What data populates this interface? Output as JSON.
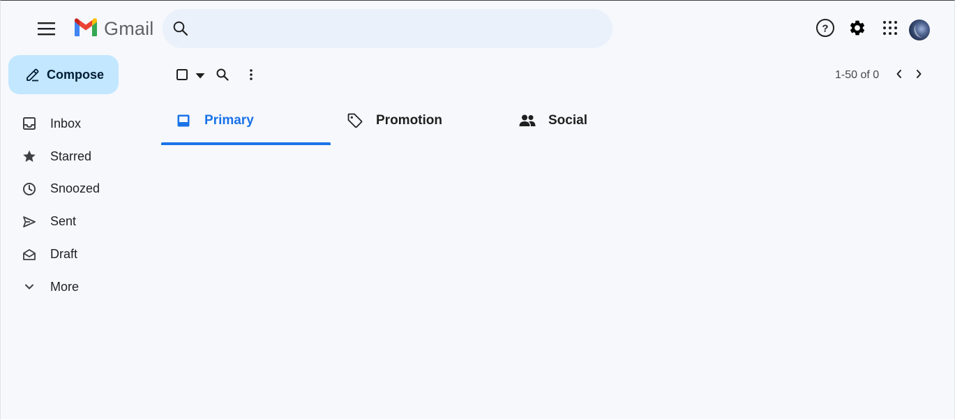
{
  "app": {
    "name": "Gmail"
  },
  "header": {
    "search_placeholder": "",
    "icons": [
      "menu-icon",
      "search-icon",
      "help-icon",
      "settings-icon",
      "apps-icon",
      "avatar"
    ]
  },
  "sidebar": {
    "compose_label": "Compose",
    "items": [
      {
        "label": "Inbox",
        "icon": "inbox-icon"
      },
      {
        "label": "Starred",
        "icon": "star-icon"
      },
      {
        "label": "Snoozed",
        "icon": "clock-icon"
      },
      {
        "label": "Sent",
        "icon": "send-icon"
      },
      {
        "label": "Draft",
        "icon": "draft-icon"
      },
      {
        "label": "More",
        "icon": "chevron-down-icon"
      }
    ]
  },
  "toolbar": {
    "page_info": "1-50 of 0"
  },
  "tabs": [
    {
      "label": "Primary",
      "icon": "inbox-icon",
      "active": true
    },
    {
      "label": "Promotion",
      "icon": "tag-icon",
      "active": false
    },
    {
      "label": "Social",
      "icon": "people-icon",
      "active": false
    }
  ],
  "colors": {
    "background": "#f6f8fc",
    "search_bg": "#eaf1fb",
    "compose_bg": "#c2e7ff",
    "accent": "#1a73e8"
  }
}
